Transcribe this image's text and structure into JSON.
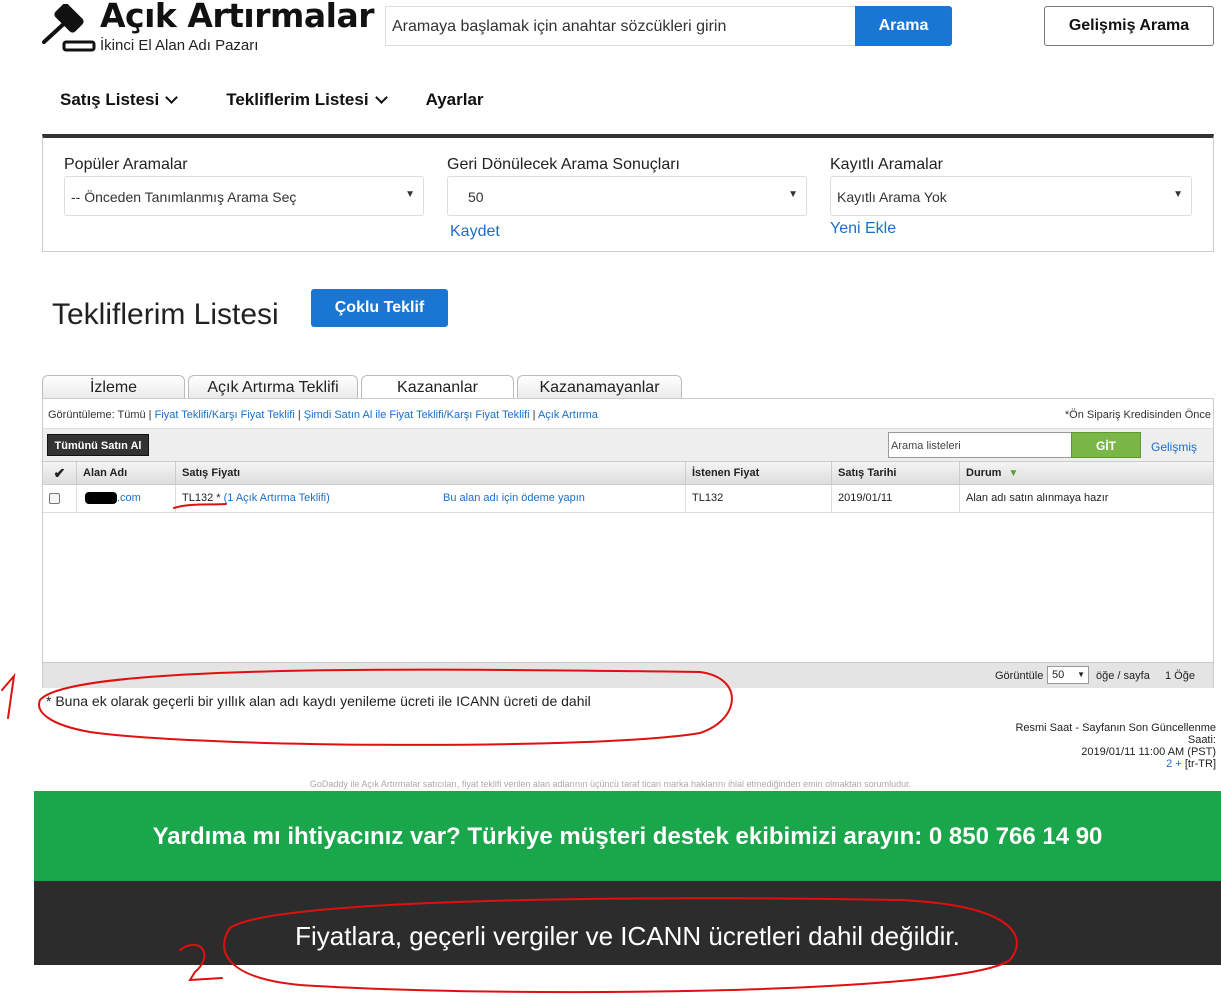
{
  "header": {
    "title": "Açık Artırmalar",
    "subtitle": "İkinci El Alan Adı Pazarı",
    "search_placeholder": "Aramaya başlamak için anahtar sözcükleri girin",
    "search_button": "Arama",
    "advanced_button": "Gelişmiş Arama",
    "icons": {
      "logo": "gavel-icon"
    }
  },
  "nav": {
    "items": [
      {
        "label": "Satış Listesi",
        "icon": "chevron-down-icon"
      },
      {
        "label": "Tekliflerim Listesi",
        "icon": "chevron-down-icon"
      },
      {
        "label": "Ayarlar"
      }
    ]
  },
  "filters": {
    "popular": {
      "label": "Popüler Aramalar",
      "value": "-- Önceden Tanımlanmış Arama Seç"
    },
    "results": {
      "label": "Geri Dönülecek Arama Sonuçları",
      "value": "50",
      "link": "Kaydet"
    },
    "saved": {
      "label": "Kayıtlı Aramalar",
      "value": "Kayıtlı Arama Yok",
      "link": "Yeni Ekle"
    }
  },
  "page": {
    "title": "Tekliflerim Listesi",
    "multi_bid_button": "Çoklu Teklif"
  },
  "tabs": [
    {
      "label": "İzleme",
      "active": false
    },
    {
      "label": "Açık Artırma Teklifi",
      "active": false
    },
    {
      "label": "Kazananlar",
      "active": true
    },
    {
      "label": "Kazanamayanlar",
      "active": false
    }
  ],
  "grid": {
    "view_prefix": "Görüntüleme: Tümü",
    "view_links": [
      "Fiyat Teklifi/Karşı Fiyat Teklifi",
      "Şimdi Satın Al ile Fiyat Teklifi/Karşı Fiyat Teklifi",
      "Açık Artırma"
    ],
    "view_note": "*Ön Sipariş Kredisinden Önce",
    "buy_all_button": "Tümünü Satın Al",
    "search_placeholder": "Arama listeleri",
    "go_button": "GİT",
    "advanced_link": "Gelişmiş",
    "columns": [
      "Alan Adı",
      "Satış Fiyatı",
      "İstenen Fiyat",
      "Satış Tarihi",
      "Durum"
    ],
    "rows": [
      {
        "domain": ".com",
        "price": "TL132 *",
        "bids": "(1 Açık Artırma Teklifi)",
        "pay_link": "Bu alan adı için ödeme yapın",
        "asking": "TL132",
        "date": "2019/01/11",
        "status": "Alan adı satın alınmaya hazır"
      }
    ],
    "footer": {
      "display_label": "Görüntüle",
      "per_page": "50",
      "per_page_suffix": "öğe / sayfa",
      "count": "1 Öğe"
    }
  },
  "note": "* Buna ek olarak geçerli bir yıllık alan adı kaydı yenileme ücreti ile ICANN ücreti de dahil",
  "server_time": {
    "line1": "Resmi Saat - Sayfanın Son Güncellenme",
    "line2": "Saati:",
    "line3": "2019/01/11 11:00 AM (PST)",
    "line4_link": "2 +",
    "line4_rest": " [tr-TR]"
  },
  "legal": "GoDaddy ile Açık Artırmalar satıcıları, fiyat teklifi verilen alan adlarının üçüncü taraf ticari marka haklarını ihlal etmediğinden emin olmaktan sorumludur.",
  "support_banner": "Yardıma mı ihtiyacınız var? Türkiye müşteri destek ekibimizi arayın: 0 850 766 14 90",
  "tax_banner": "Fiyatlara, geçerli vergiler ve ICANN ücretleri dahil değildir.",
  "annotations": {
    "mark1": "1",
    "mark2": "2",
    "color": "#e01010"
  }
}
